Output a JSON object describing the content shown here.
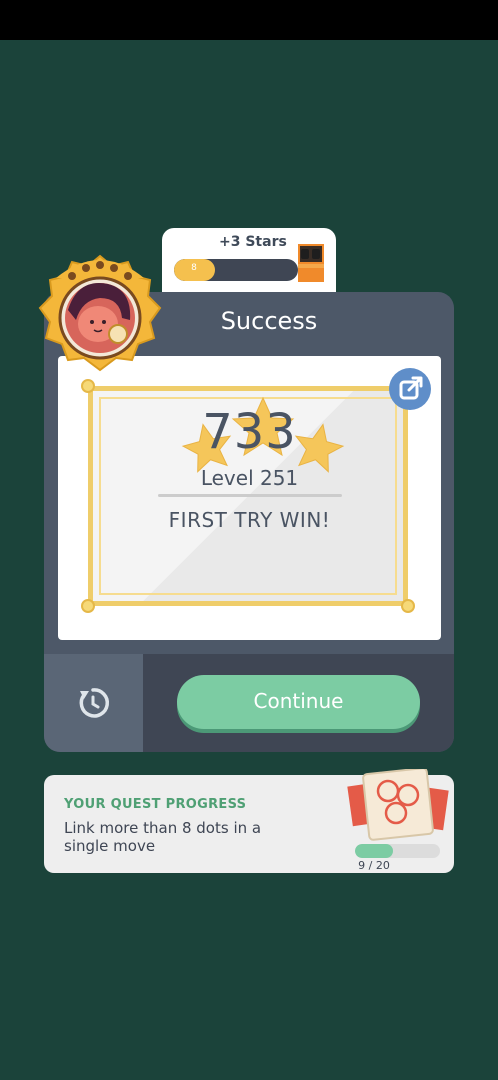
{
  "stars_tab": {
    "label": "+3 Stars",
    "progress_text": "8",
    "progress_fraction": 0.33
  },
  "result": {
    "title": "Success",
    "score": "733",
    "level": "Level 251",
    "subtitle": "FIRST TRY WIN!",
    "stars_earned": 3
  },
  "actions": {
    "continue_label": "Continue"
  },
  "quest": {
    "heading": "YOUR QUEST PROGRESS",
    "description": "Link more than 8 dots in a single move",
    "count": "9 / 20",
    "progress_fraction": 0.45
  },
  "colors": {
    "background": "#1b433a",
    "card": "#4d5868",
    "accent_green": "#7ccca3",
    "gold": "#efcd6a",
    "share_blue": "#5f8ec9"
  }
}
